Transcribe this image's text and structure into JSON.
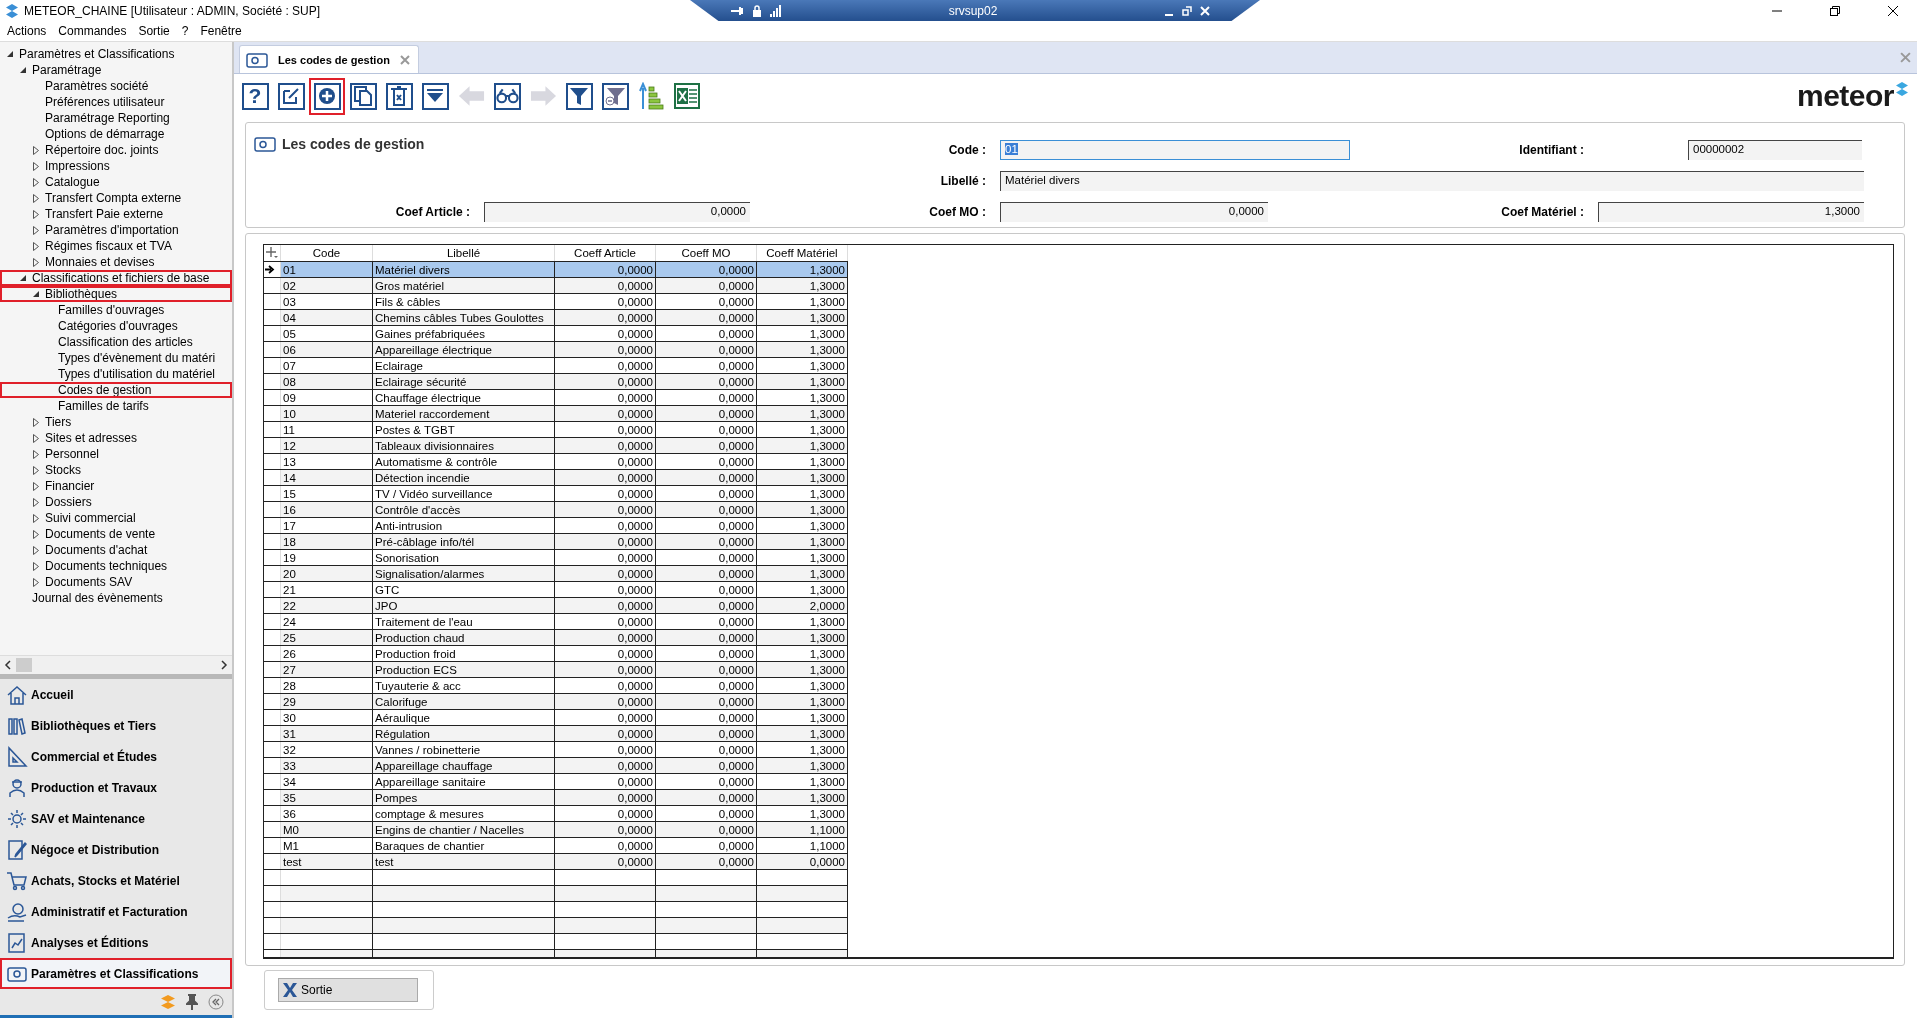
{
  "window": {
    "title": "METEOR_CHAINE [Utilisateur : ADMIN, Société : SUP]",
    "remote_session": "srvsup02"
  },
  "menu": [
    "Actions",
    "Commandes",
    "Sortie",
    "?",
    "Fenêtre"
  ],
  "tree": [
    {
      "label": "Paramètres et Classifications",
      "expanded": true,
      "highlighted": false,
      "children": [
        {
          "label": "Paramétrage",
          "expanded": true,
          "highlighted": false,
          "children": [
            {
              "label": "Paramètres société",
              "highlighted": false
            },
            {
              "label": "Préférences utilisateur",
              "highlighted": false
            },
            {
              "label": "Paramétrage Reporting",
              "highlighted": false
            },
            {
              "label": "Options de démarrage",
              "highlighted": false
            },
            {
              "label": "Répertoire doc. joints",
              "expanded": false,
              "highlighted": false
            },
            {
              "label": "Impressions",
              "expanded": false,
              "highlighted": false
            },
            {
              "label": "Catalogue",
              "expanded": false,
              "highlighted": false
            },
            {
              "label": "Transfert Compta externe",
              "expanded": false,
              "highlighted": false
            },
            {
              "label": "Transfert Paie externe",
              "expanded": false,
              "highlighted": false
            },
            {
              "label": "Paramètres d'importation",
              "expanded": false,
              "highlighted": false
            },
            {
              "label": "Régimes fiscaux et TVA",
              "expanded": false,
              "highlighted": false
            },
            {
              "label": "Monnaies et devises",
              "expanded": false,
              "highlighted": false
            }
          ]
        },
        {
          "label": "Classifications et fichiers de base",
          "expanded": true,
          "highlighted": true,
          "children": [
            {
              "label": "Bibliothèques",
              "expanded": true,
              "highlighted": true,
              "children": [
                {
                  "label": "Familles d'ouvrages",
                  "highlighted": false
                },
                {
                  "label": "Catégories d'ouvrages",
                  "highlighted": false
                },
                {
                  "label": "Classification des articles",
                  "highlighted": false
                },
                {
                  "label": "Types d'évènement du matéri",
                  "highlighted": false
                },
                {
                  "label": "Types d'utilisation du matériel",
                  "highlighted": false
                },
                {
                  "label": "Codes de gestion",
                  "highlighted": true
                },
                {
                  "label": "Familles de tarifs",
                  "highlighted": false
                }
              ]
            },
            {
              "label": "Tiers",
              "expanded": false,
              "highlighted": false
            },
            {
              "label": "Sites et adresses",
              "expanded": false,
              "highlighted": false
            },
            {
              "label": "Personnel",
              "expanded": false,
              "highlighted": false
            },
            {
              "label": "Stocks",
              "expanded": false,
              "highlighted": false
            },
            {
              "label": "Financier",
              "expanded": false,
              "highlighted": false
            },
            {
              "label": "Dossiers",
              "expanded": false,
              "highlighted": false
            },
            {
              "label": "Suivi commercial",
              "expanded": false,
              "highlighted": false
            },
            {
              "label": "Documents de vente",
              "expanded": false,
              "highlighted": false
            },
            {
              "label": "Documents d'achat",
              "expanded": false,
              "highlighted": false
            },
            {
              "label": "Documents techniques",
              "expanded": false,
              "highlighted": false
            },
            {
              "label": "Documents SAV",
              "expanded": false,
              "highlighted": false
            }
          ]
        },
        {
          "label": "Journal des évènements",
          "highlighted": false
        }
      ]
    }
  ],
  "nav": [
    {
      "label": "Accueil",
      "selected": false,
      "highlighted": false
    },
    {
      "label": "Bibliothèques et Tiers",
      "selected": false,
      "highlighted": false
    },
    {
      "label": "Commercial et Études",
      "selected": false,
      "highlighted": false
    },
    {
      "label": "Production et Travaux",
      "selected": false,
      "highlighted": false
    },
    {
      "label": "SAV et Maintenance",
      "selected": false,
      "highlighted": false
    },
    {
      "label": "Négoce et Distribution",
      "selected": false,
      "highlighted": false
    },
    {
      "label": "Achats, Stocks et Matériel",
      "selected": false,
      "highlighted": false
    },
    {
      "label": "Administratif et Facturation",
      "selected": false,
      "highlighted": false
    },
    {
      "label": "Analyses et Éditions",
      "selected": false,
      "highlighted": false
    },
    {
      "label": "Paramètres et Classifications",
      "selected": true,
      "highlighted": true
    }
  ],
  "tab": {
    "label": "Les codes de gestion",
    "selected": true
  },
  "toolbar": [
    {
      "kind": "help",
      "label": "?",
      "disabled": false,
      "highlighted": false
    },
    {
      "kind": "edit",
      "disabled": false,
      "highlighted": false
    },
    {
      "kind": "add",
      "disabled": false,
      "highlighted": true
    },
    {
      "kind": "copy",
      "disabled": false,
      "highlighted": false
    },
    {
      "kind": "delete",
      "disabled": false,
      "highlighted": false
    },
    {
      "kind": "dropdown",
      "disabled": false,
      "highlighted": false
    },
    {
      "kind": "previous",
      "disabled": true,
      "highlighted": false
    },
    {
      "kind": "search",
      "disabled": false,
      "highlighted": false
    },
    {
      "kind": "next",
      "disabled": true,
      "highlighted": false
    },
    {
      "kind": "filter",
      "disabled": false,
      "highlighted": false
    },
    {
      "kind": "filter-clear",
      "disabled": false,
      "highlighted": false
    },
    {
      "kind": "sort",
      "disabled": false,
      "highlighted": false
    },
    {
      "kind": "excel",
      "disabled": false,
      "highlighted": false
    }
  ],
  "logo": "meteor",
  "form": {
    "title": "Les codes de gestion",
    "code": {
      "label": "Code :",
      "value": "01",
      "focused": true
    },
    "identifiant": {
      "label": "Identifiant :",
      "value": "00000002"
    },
    "libelle": {
      "label": "Libellé :",
      "value": "Matériel divers"
    },
    "coef_article": {
      "label": "Coef Article :",
      "value": "0,0000"
    },
    "coef_mo": {
      "label": "Coef MO :",
      "value": "0,0000"
    },
    "coef_materiel": {
      "label": "Coef Matériel :",
      "value": "1,3000"
    }
  },
  "table": {
    "columns": [
      "Code",
      "Libellé",
      "Coeff Article",
      "Coeff MO",
      "Coeff Matériel"
    ],
    "rows": [
      {
        "cells": [
          "01",
          "Matériel divers",
          "0,0000",
          "0,0000",
          "1,3000"
        ],
        "selected": true
      },
      {
        "cells": [
          "02",
          "Gros matériel",
          "0,0000",
          "0,0000",
          "1,3000"
        ],
        "selected": false
      },
      {
        "cells": [
          "03",
          "Fils & câbles",
          "0,0000",
          "0,0000",
          "1,3000"
        ],
        "selected": false
      },
      {
        "cells": [
          "04",
          "Chemins câbles Tubes Goulottes",
          "0,0000",
          "0,0000",
          "1,3000"
        ],
        "selected": false
      },
      {
        "cells": [
          "05",
          "Gaines préfabriquées",
          "0,0000",
          "0,0000",
          "1,3000"
        ],
        "selected": false
      },
      {
        "cells": [
          "06",
          "Appareillage électrique",
          "0,0000",
          "0,0000",
          "1,3000"
        ],
        "selected": false
      },
      {
        "cells": [
          "07",
          "Eclairage",
          "0,0000",
          "0,0000",
          "1,3000"
        ],
        "selected": false
      },
      {
        "cells": [
          "08",
          "Eclairage sécurité",
          "0,0000",
          "0,0000",
          "1,3000"
        ],
        "selected": false
      },
      {
        "cells": [
          "09",
          "Chauffage électrique",
          "0,0000",
          "0,0000",
          "1,3000"
        ],
        "selected": false
      },
      {
        "cells": [
          "10",
          "Materiel raccordement",
          "0,0000",
          "0,0000",
          "1,3000"
        ],
        "selected": false
      },
      {
        "cells": [
          "11",
          "Postes & TGBT",
          "0,0000",
          "0,0000",
          "1,3000"
        ],
        "selected": false
      },
      {
        "cells": [
          "12",
          "Tableaux divisionnaires",
          "0,0000",
          "0,0000",
          "1,3000"
        ],
        "selected": false
      },
      {
        "cells": [
          "13",
          "Automatisme & contrôle",
          "0,0000",
          "0,0000",
          "1,3000"
        ],
        "selected": false
      },
      {
        "cells": [
          "14",
          "Détection incendie",
          "0,0000",
          "0,0000",
          "1,3000"
        ],
        "selected": false
      },
      {
        "cells": [
          "15",
          "TV / Vidéo surveillance",
          "0,0000",
          "0,0000",
          "1,3000"
        ],
        "selected": false
      },
      {
        "cells": [
          "16",
          "Contrôle d'accès",
          "0,0000",
          "0,0000",
          "1,3000"
        ],
        "selected": false
      },
      {
        "cells": [
          "17",
          "Anti-intrusion",
          "0,0000",
          "0,0000",
          "1,3000"
        ],
        "selected": false
      },
      {
        "cells": [
          "18",
          "Pré-câblage info/tél",
          "0,0000",
          "0,0000",
          "1,3000"
        ],
        "selected": false
      },
      {
        "cells": [
          "19",
          "Sonorisation",
          "0,0000",
          "0,0000",
          "1,3000"
        ],
        "selected": false
      },
      {
        "cells": [
          "20",
          "Signalisation/alarmes",
          "0,0000",
          "0,0000",
          "1,3000"
        ],
        "selected": false
      },
      {
        "cells": [
          "21",
          "GTC",
          "0,0000",
          "0,0000",
          "1,3000"
        ],
        "selected": false
      },
      {
        "cells": [
          "22",
          "JPO",
          "0,0000",
          "0,0000",
          "2,0000"
        ],
        "selected": false
      },
      {
        "cells": [
          "24",
          "Traitement de l'eau",
          "0,0000",
          "0,0000",
          "1,3000"
        ],
        "selected": false
      },
      {
        "cells": [
          "25",
          "Production chaud",
          "0,0000",
          "0,0000",
          "1,3000"
        ],
        "selected": false
      },
      {
        "cells": [
          "26",
          "Production froid",
          "0,0000",
          "0,0000",
          "1,3000"
        ],
        "selected": false
      },
      {
        "cells": [
          "27",
          "Production ECS",
          "0,0000",
          "0,0000",
          "1,3000"
        ],
        "selected": false
      },
      {
        "cells": [
          "28",
          "Tuyauterie & acc",
          "0,0000",
          "0,0000",
          "1,3000"
        ],
        "selected": false
      },
      {
        "cells": [
          "29",
          "Calorifuge",
          "0,0000",
          "0,0000",
          "1,3000"
        ],
        "selected": false
      },
      {
        "cells": [
          "30",
          "Aéraulique",
          "0,0000",
          "0,0000",
          "1,3000"
        ],
        "selected": false
      },
      {
        "cells": [
          "31",
          "Régulation",
          "0,0000",
          "0,0000",
          "1,3000"
        ],
        "selected": false
      },
      {
        "cells": [
          "32",
          "Vannes / robinetterie",
          "0,0000",
          "0,0000",
          "1,3000"
        ],
        "selected": false
      },
      {
        "cells": [
          "33",
          "Appareillage chauffage",
          "0,0000",
          "0,0000",
          "1,3000"
        ],
        "selected": false
      },
      {
        "cells": [
          "34",
          "Appareillage sanitaire",
          "0,0000",
          "0,0000",
          "1,3000"
        ],
        "selected": false
      },
      {
        "cells": [
          "35",
          "Pompes",
          "0,0000",
          "0,0000",
          "1,3000"
        ],
        "selected": false
      },
      {
        "cells": [
          "36",
          "comptage & mesures",
          "0,0000",
          "0,0000",
          "1,3000"
        ],
        "selected": false
      },
      {
        "cells": [
          "M0",
          "Engins de chantier / Nacelles",
          "0,0000",
          "0,0000",
          "1,1000"
        ],
        "selected": false
      },
      {
        "cells": [
          "M1",
          "Baraques de chantier",
          "0,0000",
          "0,0000",
          "1,1000"
        ],
        "selected": false
      },
      {
        "cells": [
          "test",
          "test",
          "0,0000",
          "0,0000",
          "0,0000"
        ],
        "selected": false
      }
    ]
  },
  "exit_button": "Sortie"
}
